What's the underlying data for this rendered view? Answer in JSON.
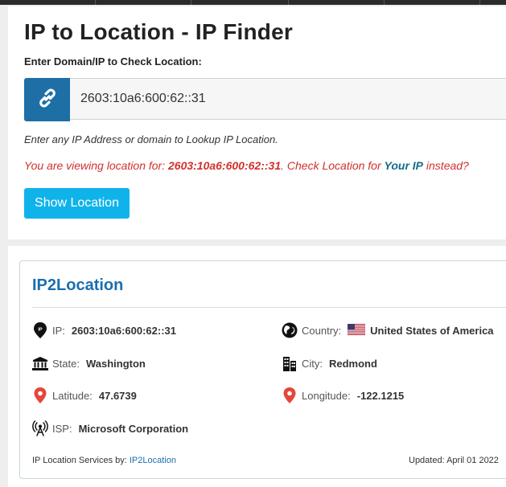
{
  "header": {
    "title": "IP to Location - IP Finder",
    "enter_label": "Enter Domain/IP to Check Location:"
  },
  "search": {
    "value": "2603:10a6:600:62::31",
    "icon": "link-icon"
  },
  "hint": "Enter any IP Address or domain to Lookup IP Location.",
  "viewing": {
    "prefix": "You are viewing location for: ",
    "ip": "2603:10a6:600:62::31",
    "middle": ". Check Location for ",
    "link": "Your IP",
    "suffix": " instead?"
  },
  "button": {
    "label": "Show Location"
  },
  "result": {
    "brand": "IP2Location",
    "ip": {
      "label": "IP:",
      "value": "2603:10a6:600:62::31",
      "icon": "map-marker-ip-icon"
    },
    "country": {
      "label": "Country:",
      "value": "United States of America",
      "icon": "globe-icon",
      "flag": "us-flag-icon"
    },
    "state": {
      "label": "State:",
      "value": "Washington",
      "icon": "building-icon"
    },
    "city": {
      "label": "City:",
      "value": "Redmond",
      "icon": "city-icon"
    },
    "latitude": {
      "label": "Latitude:",
      "value": "47.6739",
      "icon": "map-pin-icon"
    },
    "longitude": {
      "label": "Longitude:",
      "value": "-122.1215",
      "icon": "map-pin-icon"
    },
    "isp": {
      "label": "ISP:",
      "value": "Microsoft Corporation",
      "icon": "antenna-icon"
    }
  },
  "footer": {
    "services_prefix": "IP Location Services by: ",
    "services_link": "IP2Location",
    "updated": "Updated: April 01 2022"
  },
  "colors": {
    "accent_red": "#d0312d",
    "button_blue": "#0fb3ea",
    "addon_blue": "#1d6fa6",
    "brand_blue": "#1a6faf",
    "pin_red": "#e4473b"
  }
}
